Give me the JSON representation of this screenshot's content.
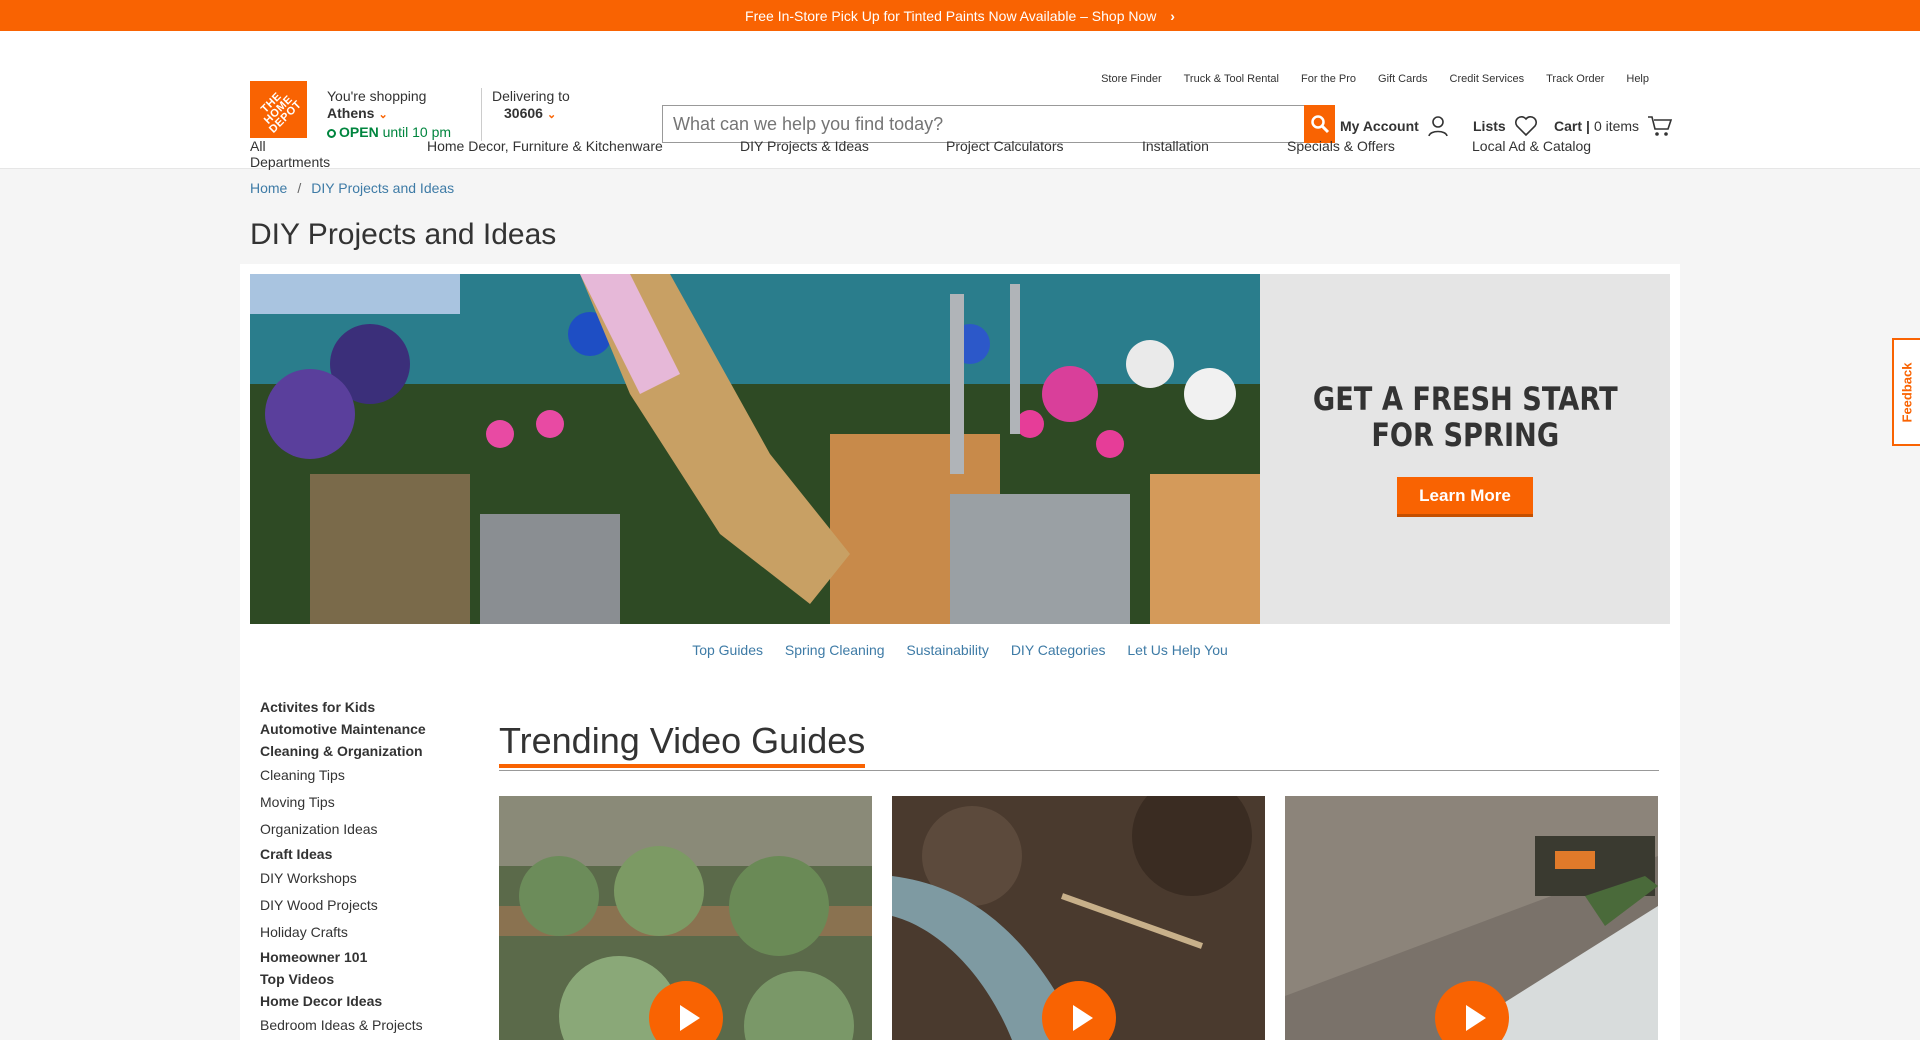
{
  "promo": {
    "text": "Free In-Store Pick Up for Tinted Paints Now Available – Shop Now",
    "chevron": "›"
  },
  "logo": {
    "text": "THE HOME DEPOT"
  },
  "store": {
    "label": "You're shopping",
    "name": "Athens",
    "open": "OPEN",
    "hours": "until 10 pm"
  },
  "delivery": {
    "label": "Delivering to",
    "zip": "30606"
  },
  "utility_links": [
    "Store Finder",
    "Truck & Tool Rental",
    "For the Pro",
    "Gift Cards",
    "Credit Services",
    "Track Order",
    "Help"
  ],
  "search": {
    "placeholder": "What can we help you find today?"
  },
  "account": {
    "my_account": "My Account",
    "lists": "Lists",
    "cart": "Cart",
    "cart_sep": "|",
    "cart_items": "0 items"
  },
  "main_nav": [
    "All Departments",
    "Home Decor, Furniture & Kitchenware",
    "DIY Projects & Ideas",
    "Project Calculators",
    "Installation",
    "Specials & Offers",
    "Local Ad & Catalog"
  ],
  "breadcrumb": {
    "home": "Home",
    "sep": "/",
    "current": "DIY Projects and Ideas"
  },
  "page_title": "DIY Projects and Ideas",
  "hero": {
    "headline_1": "GET A FRESH START",
    "headline_2": "FOR SPRING",
    "cta": "Learn More"
  },
  "sub_nav": [
    "Top Guides",
    "Spring Cleaning",
    "Sustainability",
    "DIY Categories",
    "Let Us Help You"
  ],
  "sidebar": [
    {
      "label": "Activites for Kids",
      "type": "cat"
    },
    {
      "label": "Automotive Maintenance",
      "type": "cat"
    },
    {
      "label": "Cleaning & Organization",
      "type": "cat"
    },
    {
      "label": "Cleaning Tips",
      "type": "sub"
    },
    {
      "label": "Moving Tips",
      "type": "sub"
    },
    {
      "label": "Organization Ideas",
      "type": "sub"
    },
    {
      "label": "Craft Ideas",
      "type": "cat"
    },
    {
      "label": "DIY Workshops",
      "type": "sub"
    },
    {
      "label": "DIY Wood Projects",
      "type": "sub"
    },
    {
      "label": "Holiday Crafts",
      "type": "sub"
    },
    {
      "label": "Homeowner 101",
      "type": "cat"
    },
    {
      "label": "Top Videos",
      "type": "cat"
    },
    {
      "label": "Home Decor Ideas",
      "type": "cat"
    },
    {
      "label": "Bedroom Ideas & Projects",
      "type": "sub"
    }
  ],
  "trending": {
    "title": "Trending Video Guides"
  },
  "feedback": {
    "label": "Feedback"
  },
  "colors": {
    "brand": "#f96302",
    "link": "#3e7ba6",
    "open": "#00853e"
  }
}
